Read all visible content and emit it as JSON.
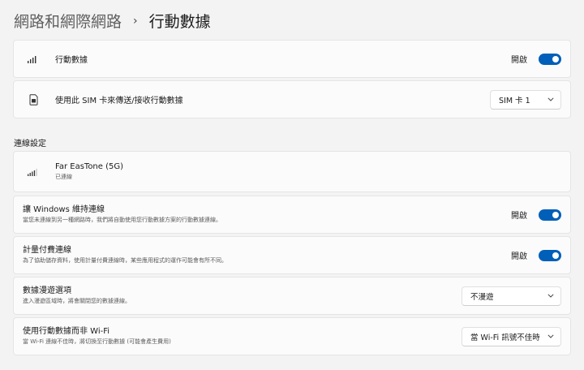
{
  "breadcrumb": {
    "parent": "網路和網際網路",
    "separator": "›",
    "current": "行動數據"
  },
  "cellular": {
    "label": "行動數據",
    "state": "開啟",
    "toggle_on": true,
    "icon": "cellular-signal-icon"
  },
  "sim": {
    "label": "使用此 SIM 卡來傳送/接收行動數據",
    "selected": "SIM 卡 1",
    "icon": "sim-card-icon"
  },
  "connection_settings": {
    "heading": "連線設定",
    "network": {
      "name": "Far EasTone (5G)",
      "status": "已連線",
      "icon": "signal-bars-icon"
    },
    "keep_connected": {
      "title": "讓 Windows 維持連線",
      "description": "當您未連線到另一種網路時，我們將自動使用您行動數據方案的行動數據連線。",
      "state": "開啟",
      "toggle_on": true
    },
    "metered": {
      "title": "計量付費連線",
      "description": "為了協助儲存資料，使用計量付費連線時，某些應用程式的運作可能會有所不同。",
      "state": "開啟",
      "toggle_on": true
    },
    "roaming": {
      "title": "數據漫遊選項",
      "description": "進入漫遊區域時，將會關閉您的數據連線。",
      "selected": "不漫遊"
    },
    "cellular_over_wifi": {
      "title": "使用行動數據而非 Wi-Fi",
      "description": "當 Wi-Fi 連線不佳時，將切換至行動數據 (可能會產生費用)",
      "selected": "當 Wi-Fi 訊號不佳時"
    }
  },
  "colors": {
    "accent": "#005fb8",
    "background": "#f3f3f3",
    "card": "#fbfbfb"
  }
}
